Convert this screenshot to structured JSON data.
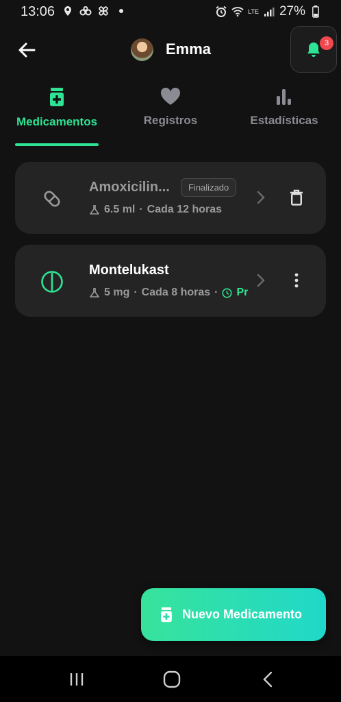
{
  "status_bar": {
    "time": "13:06",
    "battery": "27%",
    "network": "LTE",
    "icons": [
      "location-icon",
      "link-icon",
      "pinwheel-icon",
      "dot-icon",
      "alarm-icon",
      "wifi-icon",
      "signal-icon",
      "battery-icon"
    ]
  },
  "header": {
    "user_name": "Emma",
    "notification_count": "3",
    "back_icon": "arrow-left-icon",
    "bell_icon": "bell-icon"
  },
  "tabs": [
    {
      "label": "Medicamentos",
      "icon": "medicine-bottle-icon",
      "active": true
    },
    {
      "label": "Registros",
      "icon": "heart-icon",
      "active": false
    },
    {
      "label": "Estadísticas",
      "icon": "bar-chart-icon",
      "active": false
    }
  ],
  "medications": [
    {
      "name": "Amoxicilin...",
      "badge": "Finalizado",
      "dose": "6.5 ml",
      "separator": "·",
      "frequency": "Cada 12 horas",
      "icon": "pill-capsule-icon",
      "action_icon": "trash-icon"
    },
    {
      "name": "Montelukast",
      "dose": "5 mg",
      "separator": "·",
      "frequency": "Cada 8 horas",
      "separator2": "·",
      "status": "Pr",
      "icon": "tablet-icon",
      "action_icon": "more-vertical-icon"
    }
  ],
  "fab": {
    "label": "Nuevo Medicamento",
    "icon": "medicine-bottle-icon"
  },
  "colors": {
    "accent": "#2ee394",
    "background": "#121212",
    "card": "#242424",
    "muted": "#8b8b93",
    "badge": "#f0484e",
    "fab_gradient_start": "#37e39b",
    "fab_gradient_end": "#20d8c9"
  }
}
